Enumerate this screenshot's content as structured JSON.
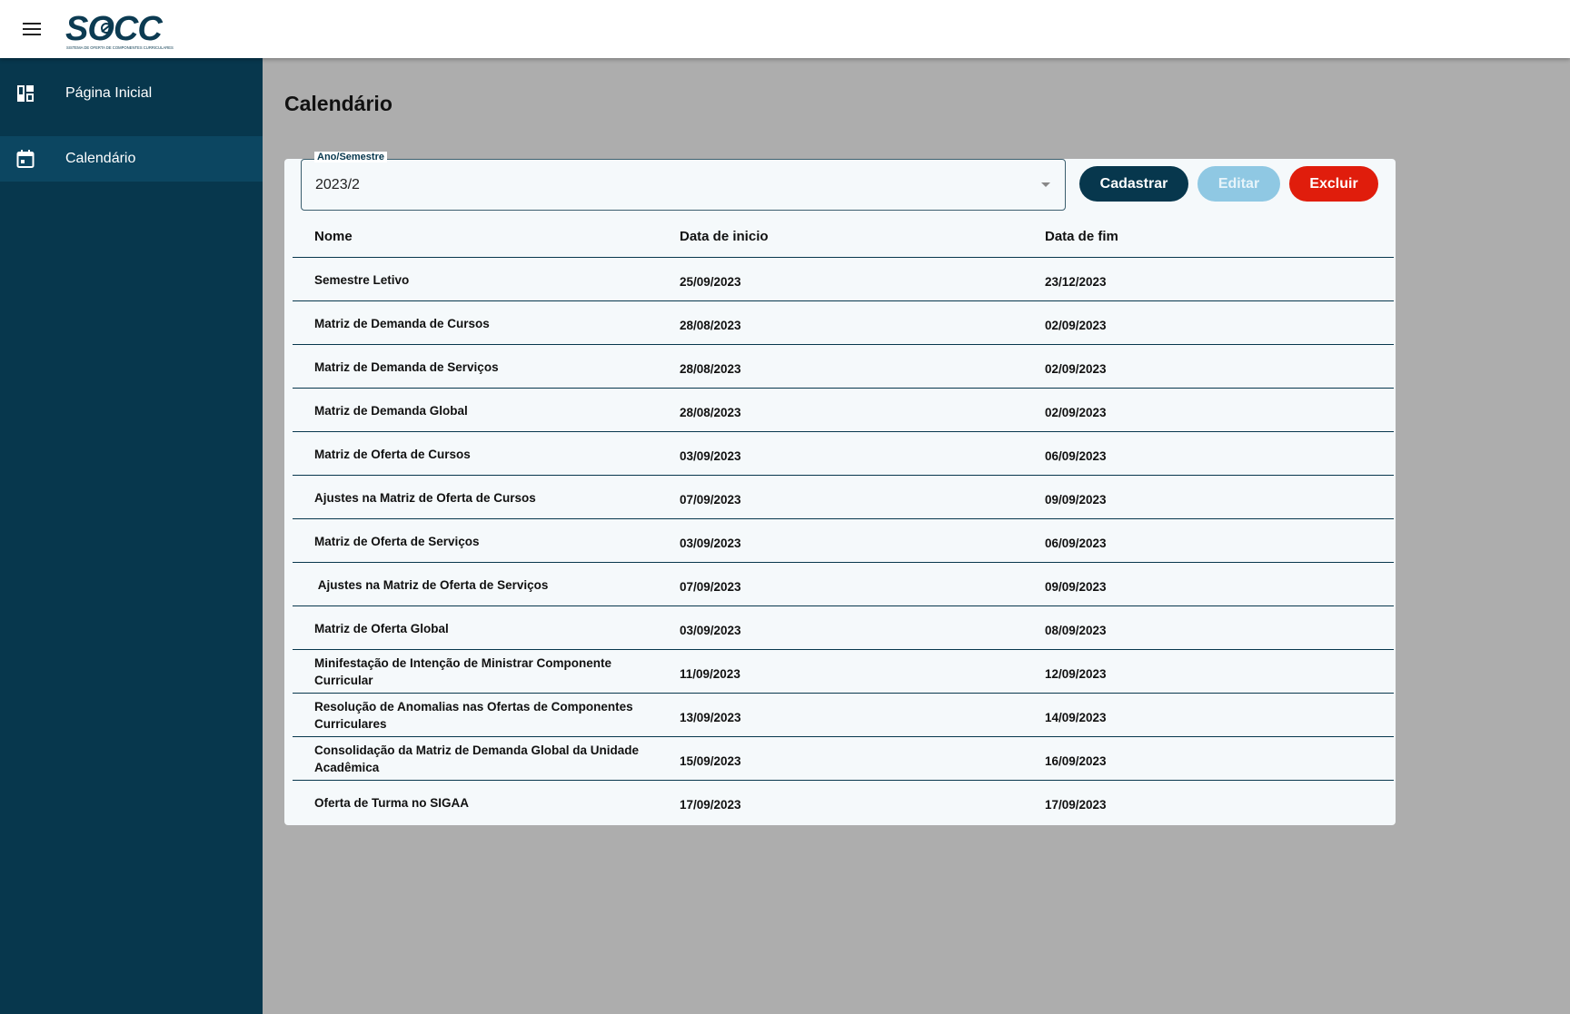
{
  "header": {
    "menu_icon": "hamburger-menu-icon",
    "logo_text": "SOCC",
    "logo_subtitle": "SISTEMA DE OFERTA DE COMPONENTES CURRICULARES"
  },
  "sidebar": {
    "items": [
      {
        "label": "Página Inicial",
        "icon": "dashboard-icon",
        "active": false
      },
      {
        "label": "Calendário",
        "icon": "calendar-icon",
        "active": true
      }
    ]
  },
  "page": {
    "title": "Calendário"
  },
  "filter": {
    "label": "Ano/Semestre",
    "value": "2023/2"
  },
  "actions": {
    "create_label": "Cadastrar",
    "edit_label": "Editar",
    "delete_label": "Excluir"
  },
  "table": {
    "headers": [
      "Nome",
      "Data de inicio",
      "Data de fim"
    ],
    "rows": [
      {
        "name": "Semestre Letivo",
        "start": "25/09/2023",
        "end": "23/12/2023"
      },
      {
        "name": "Matriz de Demanda de Cursos",
        "start": "28/08/2023",
        "end": "02/09/2023"
      },
      {
        "name": "Matriz de Demanda de Serviços",
        "start": "28/08/2023",
        "end": "02/09/2023"
      },
      {
        "name": "Matriz de Demanda Global",
        "start": "28/08/2023",
        "end": "02/09/2023"
      },
      {
        "name": "Matriz de Oferta de Cursos",
        "start": "03/09/2023",
        "end": "06/09/2023"
      },
      {
        "name": "Ajustes na Matriz de Oferta de Cursos",
        "start": "07/09/2023",
        "end": "09/09/2023"
      },
      {
        "name": "Matriz de Oferta de Serviços",
        "start": "03/09/2023",
        "end": "06/09/2023"
      },
      {
        "name": " Ajustes na Matriz de Oferta de Serviços",
        "start": "07/09/2023",
        "end": "09/09/2023"
      },
      {
        "name": "Matriz de Oferta Global",
        "start": "03/09/2023",
        "end": "08/09/2023"
      },
      {
        "name": "Minifestação de Intenção de Ministrar Componente Curricular",
        "start": "11/09/2023",
        "end": "12/09/2023"
      },
      {
        "name": "Resolução de Anomalias nas Ofertas de Componentes Curriculares",
        "start": "13/09/2023",
        "end": "14/09/2023"
      },
      {
        "name": "Consolidação da Matriz de Demanda Global da Unidade Acadêmica",
        "start": "15/09/2023",
        "end": "16/09/2023"
      },
      {
        "name": "Oferta de Turma no SIGAA",
        "start": "17/09/2023",
        "end": "17/09/2023"
      }
    ]
  },
  "colors": {
    "primary": "#07374d",
    "sidebar_active": "#0c4661",
    "danger": "#e01d0c",
    "disabled": "#8fc8e3",
    "backdrop": "#adadad"
  }
}
